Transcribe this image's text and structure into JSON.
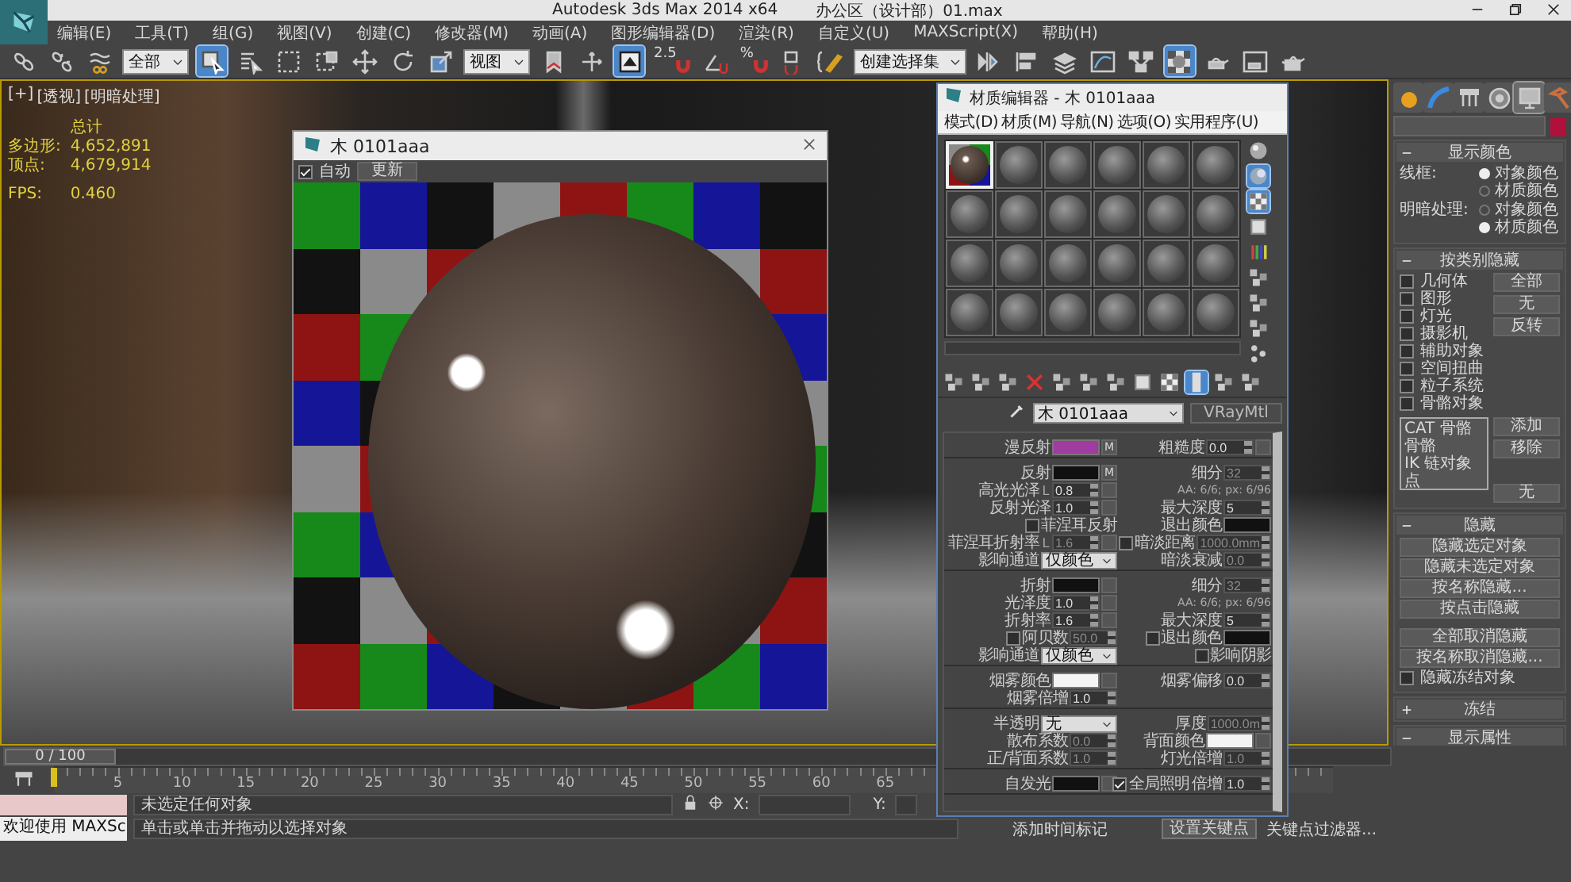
{
  "title_bar": {
    "app": "Autodesk 3ds Max  2014 x64",
    "file": "办公区（设计部）01.max"
  },
  "menu": [
    "编辑(E)",
    "工具(T)",
    "组(G)",
    "视图(V)",
    "创建(C)",
    "修改器(M)",
    "动画(A)",
    "图形编辑器(D)",
    "渲染(R)",
    "自定义(U)",
    "MAXScript(X)",
    "帮助(H)"
  ],
  "toolbar": [
    {
      "kind": "link",
      "active": false
    },
    {
      "kind": "unlink",
      "active": false
    },
    {
      "kind": "bind",
      "active": false
    },
    {
      "kind": "dropdown",
      "value": "全部"
    },
    {
      "kind": "select",
      "active": true
    },
    {
      "kind": "select-name",
      "active": false
    },
    {
      "kind": "region",
      "active": false
    },
    {
      "kind": "crossing",
      "active": false
    },
    {
      "kind": "move",
      "active": false
    },
    {
      "kind": "rotate",
      "active": false
    },
    {
      "kind": "scale",
      "active": false
    },
    {
      "kind": "dropdown",
      "value": "视图"
    },
    {
      "kind": "pivot",
      "active": false
    },
    {
      "kind": "manipulate",
      "active": false
    },
    {
      "kind": "keyboard",
      "active": true
    },
    {
      "kind": "snap",
      "label": "2.5",
      "active": false
    },
    {
      "kind": "angle",
      "active": false
    },
    {
      "kind": "snap",
      "label": "%",
      "active": false
    },
    {
      "kind": "spinner",
      "active": false
    },
    {
      "kind": "edit-named",
      "active": false
    },
    {
      "kind": "dropdown",
      "value": "创建选择集"
    },
    {
      "kind": "mirror",
      "active": false
    },
    {
      "kind": "align",
      "active": false
    },
    {
      "kind": "layers",
      "active": false
    },
    {
      "kind": "curve",
      "active": false
    },
    {
      "kind": "schematic",
      "active": false
    },
    {
      "kind": "material",
      "active": true
    },
    {
      "kind": "render-setup",
      "active": false
    },
    {
      "kind": "render-frame",
      "active": false
    },
    {
      "kind": "render",
      "active": false
    }
  ],
  "viewport": {
    "labels": [
      "[+]",
      "[透视]",
      "[明暗处理]"
    ],
    "stats_title": "总计",
    "stats": [
      {
        "label": "多边形:",
        "value": "4,652,891"
      },
      {
        "label": "顶点:",
        "value": "4,679,914"
      }
    ],
    "fps_label": "FPS:",
    "fps": "0.460"
  },
  "preview_window": {
    "title": "木 0101aaa",
    "auto": {
      "label": "自动",
      "checked": true
    },
    "update": "更新"
  },
  "material_editor": {
    "title": "材质编辑器 - 木 0101aaa",
    "menu": [
      "模式(D)",
      "材质(M)",
      "导航(N)",
      "选项(O)",
      "实用程序(U)"
    ],
    "slots": [
      {
        "kind": "wood",
        "selected": true
      },
      {
        "kind": "blank",
        "selected": false
      },
      {
        "kind": "blank",
        "selected": false
      },
      {
        "kind": "blank",
        "selected": false
      },
      {
        "kind": "blank",
        "selected": false
      },
      {
        "kind": "blank",
        "selected": false
      },
      {
        "kind": "blank",
        "selected": false
      },
      {
        "kind": "blank",
        "selected": false
      },
      {
        "kind": "blank",
        "selected": false
      },
      {
        "kind": "blank",
        "selected": false
      },
      {
        "kind": "blank",
        "selected": false
      },
      {
        "kind": "blank",
        "selected": false
      },
      {
        "kind": "blank",
        "selected": false
      },
      {
        "kind": "blank",
        "selected": false
      },
      {
        "kind": "blank",
        "selected": false
      },
      {
        "kind": "blank",
        "selected": false
      },
      {
        "kind": "blank",
        "selected": false
      },
      {
        "kind": "blank",
        "selected": false
      },
      {
        "kind": "blank",
        "selected": false
      },
      {
        "kind": "blank",
        "selected": false
      },
      {
        "kind": "blank",
        "selected": false
      },
      {
        "kind": "blank",
        "selected": false
      },
      {
        "kind": "blank",
        "selected": false
      },
      {
        "kind": "blank",
        "selected": false
      }
    ],
    "side_tools": [
      {
        "kind": "sphere",
        "active": false
      },
      {
        "kind": "backlight",
        "active": true
      },
      {
        "kind": "checker",
        "active": true
      },
      {
        "kind": "square",
        "active": false
      },
      {
        "kind": "bars",
        "active": false
      },
      {
        "kind": "cubes",
        "active": false
      },
      {
        "kind": "cubes",
        "active": false
      },
      {
        "kind": "cubes",
        "active": false
      },
      {
        "kind": "dots",
        "active": false
      }
    ],
    "bottom_tools": [
      {
        "kind": "cubes",
        "active": false
      },
      {
        "kind": "cubes",
        "active": false
      },
      {
        "kind": "cubes",
        "active": false
      },
      {
        "kind": "delete",
        "active": false
      },
      {
        "kind": "cubes",
        "active": false
      },
      {
        "kind": "cubes",
        "active": false
      },
      {
        "kind": "cubes",
        "active": false
      },
      {
        "kind": "square",
        "active": false
      },
      {
        "kind": "checker",
        "active": false
      },
      {
        "kind": "bar",
        "active": true
      },
      {
        "kind": "cubes",
        "active": false
      },
      {
        "kind": "cubes",
        "active": false
      }
    ],
    "material_name": "木 0101aaa",
    "material_type": "VRayMtl",
    "params": [
      {
        "rows": [
          {
            "left": [
              {
                "kind": "label",
                "text": "漫反射"
              },
              {
                "kind": "swatch",
                "color": "#a03ca0"
              },
              {
                "kind": "map",
                "text": "M"
              }
            ],
            "right": [
              {
                "kind": "label",
                "text": "粗糙度"
              },
              {
                "kind": "spinner",
                "value": "0.0",
                "disabled": false
              },
              {
                "kind": "map"
              }
            ]
          }
        ]
      },
      {
        "rows": [
          {
            "left": [
              {
                "kind": "label",
                "text": "反射"
              },
              {
                "kind": "swatch",
                "color": "#111111"
              },
              {
                "kind": "map",
                "text": "M"
              }
            ],
            "right": [
              {
                "kind": "label",
                "text": "细分"
              },
              {
                "kind": "spinner",
                "value": "32",
                "disabled": true
              }
            ]
          },
          {
            "left": [
              {
                "kind": "label",
                "text": "高光光泽"
              },
              {
                "kind": "lock",
                "text": "L"
              },
              {
                "kind": "spinner",
                "value": "0.8",
                "disabled": false
              },
              {
                "kind": "map"
              }
            ],
            "right": [
              {
                "kind": "note",
                "text": "AA: 6/6; px: 6/96"
              }
            ]
          },
          {
            "left": [
              {
                "kind": "label",
                "text": "反射光泽"
              },
              {
                "kind": "spinner",
                "value": "1.0",
                "disabled": false
              },
              {
                "kind": "map"
              }
            ],
            "right": [
              {
                "kind": "label",
                "text": "最大深度"
              },
              {
                "kind": "spinner",
                "value": "5",
                "disabled": false
              }
            ]
          },
          {
            "left": [
              {
                "kind": "check",
                "text": "菲涅耳反射",
                "checked": false
              }
            ],
            "right": [
              {
                "kind": "label",
                "text": "退出颜色"
              },
              {
                "kind": "swatch",
                "color": "#111111"
              }
            ]
          },
          {
            "left": [
              {
                "kind": "label",
                "text": "菲涅耳折射率"
              },
              {
                "kind": "lock",
                "text": "L"
              },
              {
                "kind": "spinner",
                "value": "1.6",
                "disabled": true
              },
              {
                "kind": "map"
              }
            ],
            "right": [
              {
                "kind": "check",
                "text": "暗淡距离",
                "checked": false
              },
              {
                "kind": "spinner",
                "value": "1000.0mm",
                "disabled": true
              }
            ]
          },
          {
            "left": [
              {
                "kind": "label",
                "text": "影响通道"
              },
              {
                "kind": "dropdown",
                "value": "仅颜色"
              }
            ],
            "right": [
              {
                "kind": "label",
                "text": "暗淡衰减"
              },
              {
                "kind": "spinner",
                "value": "0.0",
                "disabled": true
              }
            ]
          }
        ]
      },
      {
        "rows": [
          {
            "left": [
              {
                "kind": "label",
                "text": "折射"
              },
              {
                "kind": "swatch",
                "color": "#111111"
              },
              {
                "kind": "map"
              }
            ],
            "right": [
              {
                "kind": "label",
                "text": "细分"
              },
              {
                "kind": "spinner",
                "value": "32",
                "disabled": true
              }
            ]
          },
          {
            "left": [
              {
                "kind": "label",
                "text": "光泽度"
              },
              {
                "kind": "spinner",
                "value": "1.0",
                "disabled": false
              },
              {
                "kind": "map"
              }
            ],
            "right": [
              {
                "kind": "note",
                "text": "AA: 6/6; px: 6/96"
              }
            ]
          },
          {
            "left": [
              {
                "kind": "label",
                "text": "折射率"
              },
              {
                "kind": "spinner",
                "value": "1.6",
                "disabled": false
              },
              {
                "kind": "map"
              }
            ],
            "right": [
              {
                "kind": "label",
                "text": "最大深度"
              },
              {
                "kind": "spinner",
                "value": "5",
                "disabled": false
              }
            ]
          },
          {
            "left": [
              {
                "kind": "check",
                "text": "阿贝数",
                "checked": false
              },
              {
                "kind": "spinner",
                "value": "50.0",
                "disabled": true
              }
            ],
            "right": [
              {
                "kind": "check",
                "text": "退出颜色",
                "checked": false
              },
              {
                "kind": "swatch",
                "color": "#111111"
              }
            ]
          },
          {
            "left": [
              {
                "kind": "label",
                "text": "影响通道"
              },
              {
                "kind": "dropdown",
                "value": "仅颜色"
              }
            ],
            "right": [
              {
                "kind": "check",
                "text": "影响阴影",
                "checked": false
              }
            ]
          }
        ]
      },
      {
        "rows": [
          {
            "left": [
              {
                "kind": "label",
                "text": "烟雾颜色"
              },
              {
                "kind": "swatch",
                "color": "#f4f4f4"
              },
              {
                "kind": "map"
              }
            ],
            "right": [
              {
                "kind": "label",
                "text": "烟雾偏移"
              },
              {
                "kind": "spinner",
                "value": "0.0",
                "disabled": false
              }
            ]
          },
          {
            "left": [
              {
                "kind": "label",
                "text": "烟雾倍增"
              },
              {
                "kind": "spinner",
                "value": "1.0",
                "disabled": false
              }
            ],
            "right": []
          }
        ]
      },
      {
        "rows": [
          {
            "left": [
              {
                "kind": "label",
                "text": "半透明"
              },
              {
                "kind": "dropdown",
                "value": "无"
              }
            ],
            "right": [
              {
                "kind": "label",
                "text": "厚度"
              },
              {
                "kind": "spinner",
                "value": "1000.0m",
                "disabled": true
              }
            ]
          },
          {
            "left": [
              {
                "kind": "label",
                "text": "散布系数"
              },
              {
                "kind": "spinner",
                "value": "0.0",
                "disabled": true
              }
            ],
            "right": [
              {
                "kind": "label",
                "text": "背面颜色"
              },
              {
                "kind": "swatch",
                "color": "#f4f4f4"
              },
              {
                "kind": "map"
              }
            ]
          },
          {
            "left": [
              {
                "kind": "label",
                "text": "正/背面系数"
              },
              {
                "kind": "spinner",
                "value": "1.0",
                "disabled": true
              }
            ],
            "right": [
              {
                "kind": "label",
                "text": "灯光倍增"
              },
              {
                "kind": "spinner",
                "value": "1.0",
                "disabled": true
              }
            ]
          }
        ]
      },
      {
        "rows": [
          {
            "left": [
              {
                "kind": "label",
                "text": "自发光"
              },
              {
                "kind": "swatch",
                "color": "#111111"
              },
              {
                "kind": "map"
              }
            ],
            "right": [
              {
                "kind": "check",
                "text": "全局照明",
                "checked": true
              },
              {
                "kind": "label",
                "text": "倍增"
              },
              {
                "kind": "spinner",
                "value": "1.0",
                "disabled": false
              }
            ]
          }
        ]
      }
    ]
  },
  "command_panel": {
    "tabs": [
      {
        "kind": "create",
        "selected": false
      },
      {
        "kind": "modify",
        "selected": false
      },
      {
        "kind": "hierarchy",
        "selected": false
      },
      {
        "kind": "motion",
        "selected": false
      },
      {
        "kind": "display",
        "selected": true
      },
      {
        "kind": "utilities",
        "selected": false
      }
    ],
    "object_color": {
      "color": "#b0103a"
    },
    "rollouts": [
      {
        "kind": "display-color",
        "title": "显示颜色",
        "expanded": true,
        "groups": [
          {
            "label": "线框:",
            "options": [
              {
                "label": "对象颜色",
                "selected": true
              },
              {
                "label": "材质颜色",
                "selected": false
              }
            ]
          },
          {
            "label": "明暗处理:",
            "options": [
              {
                "label": "对象颜色",
                "selected": false
              },
              {
                "label": "材质颜色",
                "selected": true
              }
            ]
          }
        ]
      },
      {
        "kind": "hide-category",
        "title": "按类别隐藏",
        "expanded": true,
        "categories": [
          {
            "label": "几何体",
            "checked": false
          },
          {
            "label": "图形",
            "checked": false
          },
          {
            "label": "灯光",
            "checked": false
          },
          {
            "label": "摄影机",
            "checked": false
          },
          {
            "label": "辅助对象",
            "checked": false
          },
          {
            "label": "空间扭曲",
            "checked": false
          },
          {
            "label": "粒子系统",
            "checked": false
          },
          {
            "label": "骨骼对象",
            "checked": false
          }
        ],
        "buttons": [
          "全部",
          "无",
          "反转"
        ],
        "list": [
          "CAT 骨骼",
          "骨骼",
          "IK 链对象",
          "点"
        ],
        "list_buttons": [
          "添加",
          "移除",
          "无"
        ]
      },
      {
        "kind": "hide",
        "title": "隐藏",
        "expanded": true,
        "buttons": [
          "隐藏选定对象",
          "隐藏未选定对象",
          "按名称隐藏...",
          "按点击隐藏",
          "全部取消隐藏",
          "按名称取消隐藏..."
        ],
        "checks": [
          {
            "label": "隐藏冻结对象",
            "checked": false
          }
        ]
      },
      {
        "kind": "plain",
        "title": "冻结",
        "expanded": false
      },
      {
        "kind": "plain",
        "title": "显示属性",
        "expanded": true
      }
    ]
  },
  "timeline": {
    "position": "0 / 100",
    "level": 0,
    "labels": [
      "5",
      "10",
      "15",
      "20",
      "25",
      "30",
      "35",
      "40",
      "45",
      "50",
      "55",
      "60",
      "65"
    ]
  },
  "status_bar": {
    "listener": "欢迎使用 MAXSc",
    "selection": "未选定任何对象",
    "prompt": "单击或单击并拖动以选择对象",
    "x_label": "X:",
    "y_label": "Y:",
    "time_tag": "添加时间标记",
    "set_key": "设置关键点",
    "key_filters": "关键点过滤器..."
  }
}
